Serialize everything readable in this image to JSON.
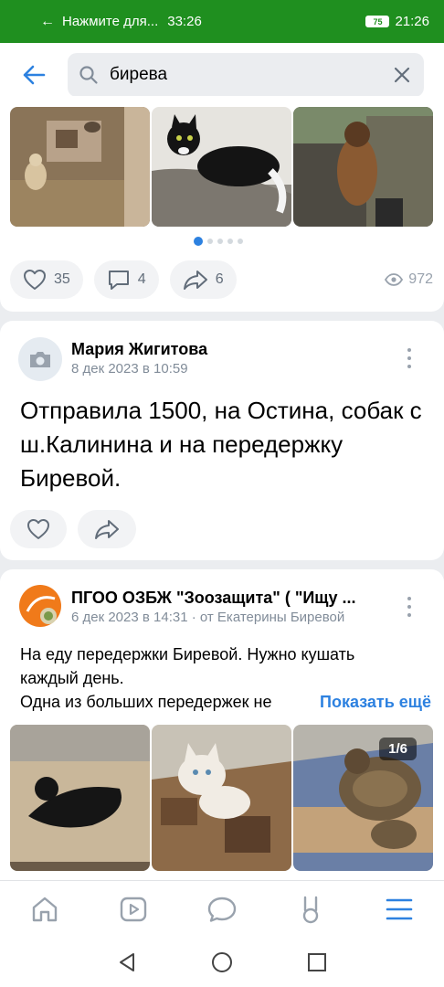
{
  "status_bar": {
    "call_text": "Нажмите для...",
    "call_timer": "33:26",
    "battery": "75",
    "clock": "21:26"
  },
  "search": {
    "query": "бирева"
  },
  "post1": {
    "likes": "35",
    "comments": "4",
    "shares": "6",
    "views": "972"
  },
  "post2": {
    "author": "Мария Жигитова",
    "date": "8 дек 2023 в 10:59",
    "text": "Отправила 1500, на Остина, собак с ш.Калинина и на передержку Биревой."
  },
  "post3": {
    "author": "ПГОО ОЗБЖ \"Зоозащита\" ( \"Ищу ...",
    "date": "6 дек 2023 в 14:31 · от Екатерины Биревой",
    "text_line1": "На еду передержки Биревой. Нужно кушать",
    "text_line2": "каждый день.",
    "text_line3": "Одна из больших передержек не",
    "show_more": "Показать ещё",
    "photo_counter": "1/6"
  },
  "colors": {
    "accent": "#2d81e0",
    "status_bar": "#1f8f1f",
    "background": "#ebedf0"
  },
  "icons": {
    "nav": [
      "home-icon",
      "video-icon",
      "messages-icon",
      "services-icon",
      "menu-icon"
    ]
  }
}
